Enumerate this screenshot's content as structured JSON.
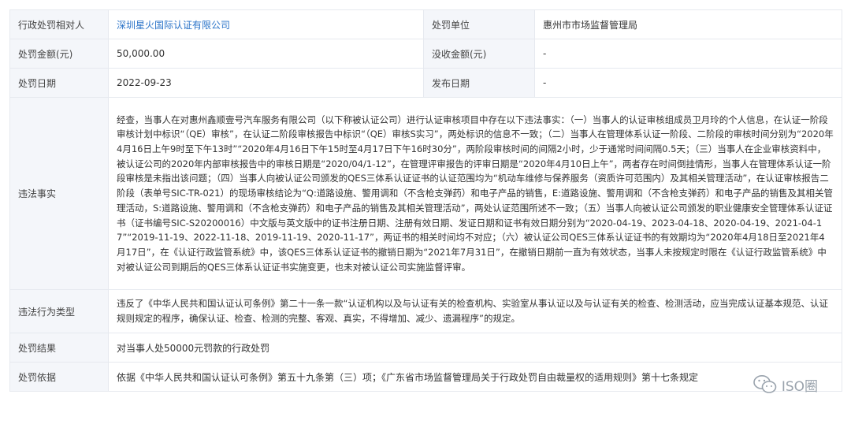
{
  "rows": {
    "party_label": "行政处罚相对人",
    "party_value": "深圳星火国际认证有限公司",
    "unit_label": "处罚单位",
    "unit_value": "惠州市市场监督管理局",
    "amount_label": "处罚金额(元)",
    "amount_value": "50,000.00",
    "confiscate_label": "没收金额(元)",
    "confiscate_value": "-",
    "date_label": "处罚日期",
    "date_value": "2022-09-23",
    "publish_label": "发布日期",
    "publish_value": "-",
    "facts_label": "违法事实",
    "facts_value": "经查，当事人在对惠州鑫顺壹号汽车服务有限公司（以下称被认证公司）进行认证审核项目中存在以下违法事实：（一）当事人的认证审核组成员卫月玲的个人信息，在认证一阶段审核计划中标识“（QE）审核”，在认证二阶段审核报告中标识“（QE）审核S实习”，两处标识的信息不一致；（二）当事人在管理体系认证一阶段、二阶段的审核时间分别为“2020年4月16日上午9时至下午13时”“2020年4月16日下午15时至4月17日下午16时30分”，两阶段审核时间的间隔2小时，少于通常时间间隔0.5天；（三）当事人在企业审核资料中，被认证公司的2020年内部审核报告中的审核日期是“2020/04/1-12”，在管理评审报告的评审日期是“2020年4月10日上午”，两者存在时间倒挂情形，当事人在管理体系认证一阶段审核是未指出该问题；（四）当事人向被认证公司颁发的QES三体系认证证书的认证范围均为“机动车维修与保养服务（资质许可范围内）及其相关管理活动”，在认证审核报告二阶段（表单号SIC-TR-021）的现场审核结论为“Q:道路设施、警用调和（不含枪支弹药）和电子产品的销售，E:道路设施、警用调和（不含枪支弹药）和电子产品的销售及其相关管理活动，S:道路设施、警用调和（不含枪支弹药）和电子产品的销售及其相关管理活动”，两处认证范围所述不一致；（五）当事人向被认证公司颁发的职业健康安全管理体系认证证书（证书编号SIC-S20200016）中文版与英文版中的证书注册日期、注册有效日期、发证日期和证书有效日期分别为“2020-04-19、2023-04-18、2020-04-19、2021-04-17”“2019-11-19、2022-11-18、2019-11-19、2020-11-17”，两证书的相关时间均不对应；（六）被认证公司QES三体系认证证书的有效期均为“2020年4月18日至2021年4月17日”，在《认证行政监管系统》中，该QES三体系认证证书的撤销日期为“2021年7月31日”，在撤销日期前一直为有效状态，当事人未按规定时限在《认证行政监管系统》中对被认证公司到期后的QES三体系认证证书实施变更，也未对被认证公司实施监督评审。",
    "type_label": "违法行为类型",
    "type_value": "违反了《中华人民共和国认证认可条例》第二十一条一款“认证机构以及与认证有关的检查机构、实验室从事认证以及与认证有关的检查、检测活动，应当完成认证基本规范、认证规则规定的程序，确保认证、检查、检测的完整、客观、真实，不得增加、减少、遗漏程序”的规定。",
    "result_label": "处罚结果",
    "result_value": "对当事人处50000元罚款的行政处罚",
    "basis_label": "处罚依据",
    "basis_value": "依据《中华人民共和国认证认可条例》第五十九条第（三）项；《广东省市场监督管理局关于行政处罚自由裁量权的适用规则》第十七条规定"
  },
  "footer": {
    "logo_icon": "wechat-icon",
    "logo_text": "ISO圈"
  }
}
